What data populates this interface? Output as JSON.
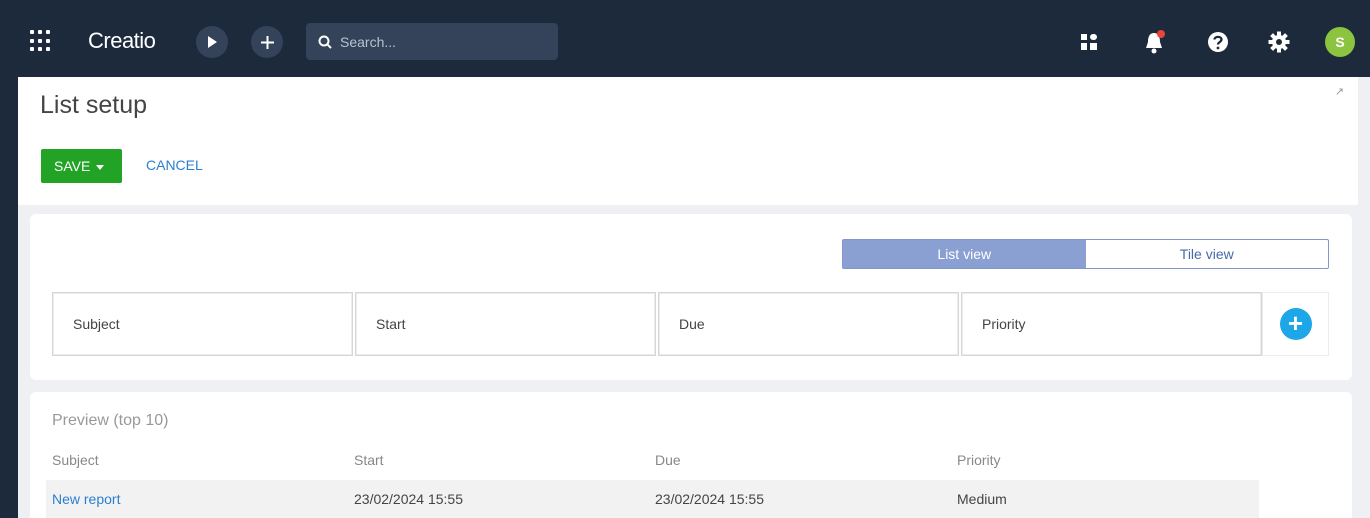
{
  "topbar": {
    "app_name": "Creatio",
    "search_placeholder": "Search...",
    "avatar_initial": "S",
    "icons": [
      "apps-grid-icon",
      "play-icon",
      "plus-icon",
      "search-icon",
      "dashboard-icon",
      "bell-icon",
      "help-icon",
      "gear-icon"
    ],
    "notification_dot_color": "#e8463a"
  },
  "header": {
    "title": "List setup",
    "save_label": "SAVE",
    "cancel_label": "CANCEL"
  },
  "view_toggle": {
    "list_label": "List view",
    "tile_label": "Tile view",
    "active": "List view"
  },
  "columns": [
    "Subject",
    "Start",
    "Due",
    "Priority"
  ],
  "preview": {
    "title": "Preview (top 10)",
    "headers": [
      "Subject",
      "Start",
      "Due",
      "Priority"
    ],
    "rows": [
      [
        "New report",
        "23/02/2024 15:55",
        "23/02/2024 15:55",
        "Medium"
      ]
    ]
  },
  "colors": {
    "topbar_bg": "#1d2a3c",
    "save_green": "#23a326",
    "link_blue": "#2b7fd1",
    "toggle_active": "#8aa0d2",
    "add_button_blue": "#1ea7e8",
    "avatar_green": "#8cc43f"
  }
}
